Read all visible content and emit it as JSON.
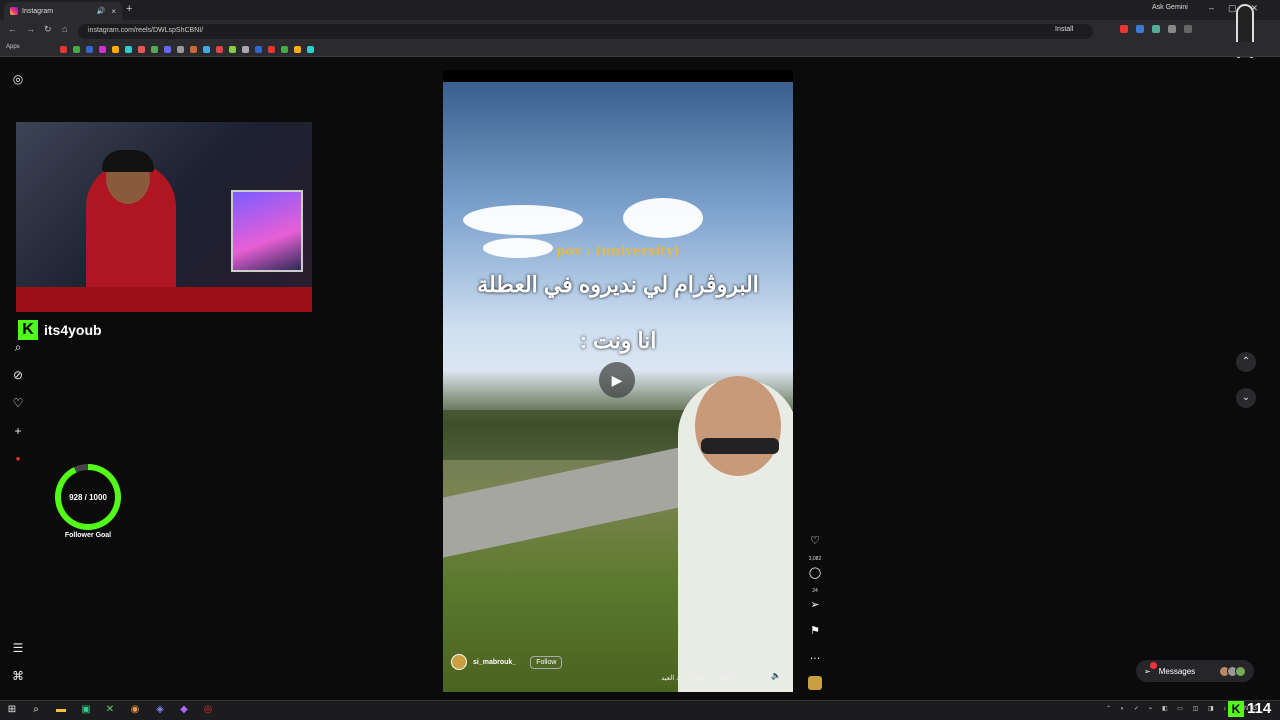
{
  "browser": {
    "tab_title": "Instagram",
    "url": "instagram.com/reels/DWLspShCBNI/",
    "ask_gemini": "Ask Gemini",
    "install_label": "Install",
    "apps_label": "Apps"
  },
  "stream": {
    "streamer_name": "its4youb",
    "follower_goal_value": "928 / 1000",
    "follower_goal_label": "Follower Goal",
    "viewers": "114"
  },
  "reel": {
    "caption_en": "pov : (university)",
    "caption_ar_line1": "البروڤرام لي نديروه في العطلة",
    "caption_ar_line2": "انا ونت :",
    "username": "si_mabrouk_",
    "follow_label": "Follow",
    "description": "more ... بروفرام بعد العيد",
    "likes": "3,082",
    "comments": "24"
  },
  "messages": {
    "label": "Messages",
    "unread": "5"
  },
  "colors": {
    "kick_green": "#53fc18",
    "caption_gold": "#e6b84a",
    "notification_red": "#ff3040"
  }
}
